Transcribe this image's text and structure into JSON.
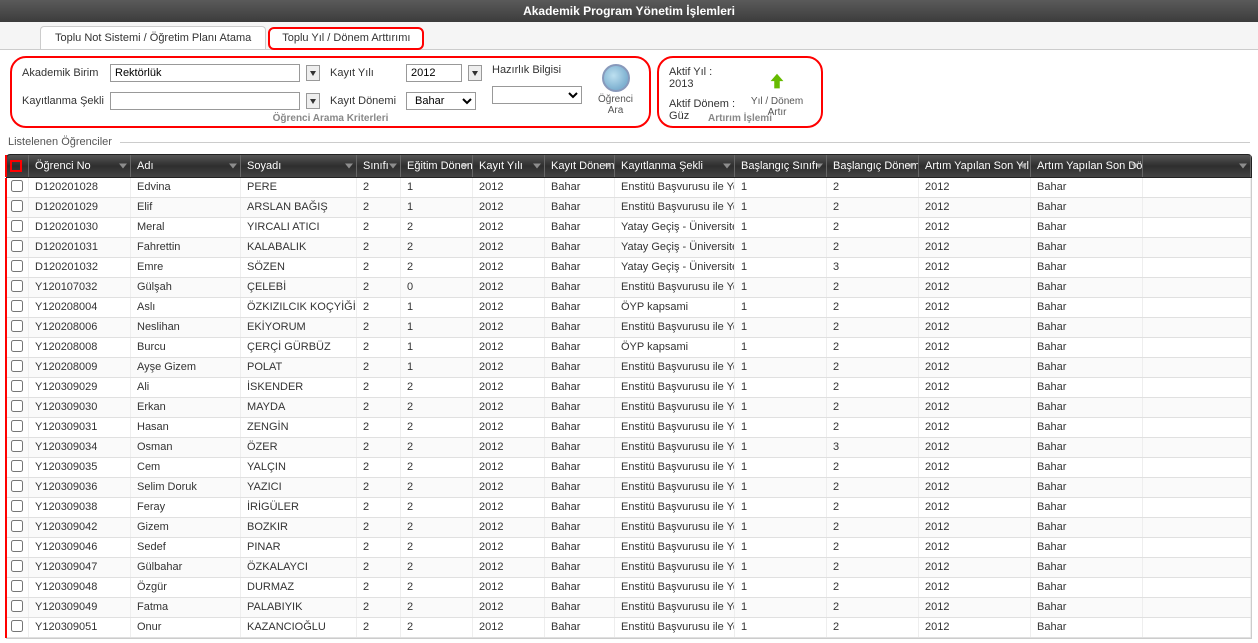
{
  "header": {
    "title": "Akademik Program Yönetim İşlemleri"
  },
  "tabs": [
    {
      "label": "Toplu Not Sistemi / Öğretim Planı Atama"
    },
    {
      "label": "Toplu Yıl / Dönem Arttırımı"
    }
  ],
  "criteria": {
    "title": "Öğrenci Arama Kriterleri",
    "akademik_birim_label": "Akademik Birim",
    "akademik_birim_value": "Rektörlük",
    "kayit_yili_label": "Kayıt Yılı",
    "kayit_yili_value": "2012",
    "hazirlik_label": "Hazırlık Bilgisi",
    "hazirlik_value": "",
    "kayitlanma_label": "Kayıtlanma Şekli",
    "kayitlanma_value": "",
    "kayit_donemi_label": "Kayıt Dönemi",
    "kayit_donemi_value": "Bahar",
    "search_label": "Öğrenci Ara"
  },
  "increment": {
    "title": "Artırım İşlemi",
    "aktif_yil_label": "Aktif Yıl :",
    "aktif_yil_value": "2013",
    "aktif_donem_label": "Aktif Dönem :",
    "aktif_donem_value": "Güz",
    "action_label": "Yıl / Dönem Artır"
  },
  "list_title": "Listelenen Öğrenciler",
  "columns": {
    "ogrno": "Öğrenci No",
    "adi": "Adı",
    "soyadi": "Soyadı",
    "sinifi": "Sınıfı",
    "egitim": "Eğitim Dönem",
    "kayityil": "Kayıt Yılı",
    "kayitdon": "Kayıt Dönemi",
    "kayitsek": "Kayıtlanma Şekli",
    "bassin": "Başlangıç Sınıfı",
    "basdon": "Başlangıç Dönem",
    "artyil": "Artım Yapılan Son Yıl",
    "artdon": "Artım Yapılan Son Dön"
  },
  "rows": [
    {
      "ogrno": "D120201028",
      "adi": "Edvina",
      "soyadi": "PERE",
      "sinifi": "2",
      "egitim": "1",
      "kayityil": "2012",
      "kayitdon": "Bahar",
      "kayitsek": "Enstitü Başvurusu ile Yerl",
      "bassin": "1",
      "basdon": "2",
      "artyil": "2012",
      "artdon": "Bahar"
    },
    {
      "ogrno": "D120201029",
      "adi": "Elif",
      "soyadi": "ARSLAN BAĞIŞ",
      "sinifi": "2",
      "egitim": "1",
      "kayityil": "2012",
      "kayitdon": "Bahar",
      "kayitsek": "Enstitü Başvurusu ile Yerl",
      "bassin": "1",
      "basdon": "2",
      "artyil": "2012",
      "artdon": "Bahar"
    },
    {
      "ogrno": "D120201030",
      "adi": "Meral",
      "soyadi": "YIRCALI ATICI",
      "sinifi": "2",
      "egitim": "2",
      "kayityil": "2012",
      "kayitdon": "Bahar",
      "kayitsek": "Yatay Geçiş - Üniversite İ",
      "bassin": "1",
      "basdon": "2",
      "artyil": "2012",
      "artdon": "Bahar"
    },
    {
      "ogrno": "D120201031",
      "adi": "Fahrettin",
      "soyadi": "KALABALIK",
      "sinifi": "2",
      "egitim": "2",
      "kayityil": "2012",
      "kayitdon": "Bahar",
      "kayitsek": "Yatay Geçiş - Üniversite D",
      "bassin": "1",
      "basdon": "2",
      "artyil": "2012",
      "artdon": "Bahar"
    },
    {
      "ogrno": "D120201032",
      "adi": "Emre",
      "soyadi": "SÖZEN",
      "sinifi": "2",
      "egitim": "2",
      "kayityil": "2012",
      "kayitdon": "Bahar",
      "kayitsek": "Yatay Geçiş - Üniversite İ",
      "bassin": "1",
      "basdon": "3",
      "artyil": "2012",
      "artdon": "Bahar"
    },
    {
      "ogrno": "Y120107032",
      "adi": "Gülşah",
      "soyadi": "ÇELEBİ",
      "sinifi": "2",
      "egitim": "0",
      "kayityil": "2012",
      "kayitdon": "Bahar",
      "kayitsek": "Enstitü Başvurusu ile Yerl",
      "bassin": "1",
      "basdon": "2",
      "artyil": "2012",
      "artdon": "Bahar"
    },
    {
      "ogrno": "Y120208004",
      "adi": "Aslı",
      "soyadi": "ÖZKIZILCIK KOÇYİĞİT",
      "sinifi": "2",
      "egitim": "1",
      "kayityil": "2012",
      "kayitdon": "Bahar",
      "kayitsek": "ÖYP kapsami",
      "bassin": "1",
      "basdon": "2",
      "artyil": "2012",
      "artdon": "Bahar"
    },
    {
      "ogrno": "Y120208006",
      "adi": "Neslihan",
      "soyadi": "EKİYORUM",
      "sinifi": "2",
      "egitim": "1",
      "kayityil": "2012",
      "kayitdon": "Bahar",
      "kayitsek": "Enstitü Başvurusu ile Yerl",
      "bassin": "1",
      "basdon": "2",
      "artyil": "2012",
      "artdon": "Bahar"
    },
    {
      "ogrno": "Y120208008",
      "adi": "Burcu",
      "soyadi": "ÇERÇİ GÜRBÜZ",
      "sinifi": "2",
      "egitim": "1",
      "kayityil": "2012",
      "kayitdon": "Bahar",
      "kayitsek": "ÖYP kapsami",
      "bassin": "1",
      "basdon": "2",
      "artyil": "2012",
      "artdon": "Bahar"
    },
    {
      "ogrno": "Y120208009",
      "adi": "Ayşe Gizem",
      "soyadi": "POLAT",
      "sinifi": "2",
      "egitim": "1",
      "kayityil": "2012",
      "kayitdon": "Bahar",
      "kayitsek": "Enstitü Başvurusu ile Yerl",
      "bassin": "1",
      "basdon": "2",
      "artyil": "2012",
      "artdon": "Bahar"
    },
    {
      "ogrno": "Y120309029",
      "adi": "Ali",
      "soyadi": "İSKENDER",
      "sinifi": "2",
      "egitim": "2",
      "kayityil": "2012",
      "kayitdon": "Bahar",
      "kayitsek": "Enstitü Başvurusu ile Yerl",
      "bassin": "1",
      "basdon": "2",
      "artyil": "2012",
      "artdon": "Bahar"
    },
    {
      "ogrno": "Y120309030",
      "adi": "Erkan",
      "soyadi": "MAYDA",
      "sinifi": "2",
      "egitim": "2",
      "kayityil": "2012",
      "kayitdon": "Bahar",
      "kayitsek": "Enstitü Başvurusu ile Yerl",
      "bassin": "1",
      "basdon": "2",
      "artyil": "2012",
      "artdon": "Bahar"
    },
    {
      "ogrno": "Y120309031",
      "adi": "Hasan",
      "soyadi": "ZENGİN",
      "sinifi": "2",
      "egitim": "2",
      "kayityil": "2012",
      "kayitdon": "Bahar",
      "kayitsek": "Enstitü Başvurusu ile Yerl",
      "bassin": "1",
      "basdon": "2",
      "artyil": "2012",
      "artdon": "Bahar"
    },
    {
      "ogrno": "Y120309034",
      "adi": "Osman",
      "soyadi": "ÖZER",
      "sinifi": "2",
      "egitim": "2",
      "kayityil": "2012",
      "kayitdon": "Bahar",
      "kayitsek": "Enstitü Başvurusu ile Yerl",
      "bassin": "1",
      "basdon": "3",
      "artyil": "2012",
      "artdon": "Bahar"
    },
    {
      "ogrno": "Y120309035",
      "adi": "Cem",
      "soyadi": "YALÇIN",
      "sinifi": "2",
      "egitim": "2",
      "kayityil": "2012",
      "kayitdon": "Bahar",
      "kayitsek": "Enstitü Başvurusu ile Yerl",
      "bassin": "1",
      "basdon": "2",
      "artyil": "2012",
      "artdon": "Bahar"
    },
    {
      "ogrno": "Y120309036",
      "adi": "Selim Doruk",
      "soyadi": "YAZICI",
      "sinifi": "2",
      "egitim": "2",
      "kayityil": "2012",
      "kayitdon": "Bahar",
      "kayitsek": "Enstitü Başvurusu ile Yerl",
      "bassin": "1",
      "basdon": "2",
      "artyil": "2012",
      "artdon": "Bahar"
    },
    {
      "ogrno": "Y120309038",
      "adi": "Feray",
      "soyadi": "İRİGÜLER",
      "sinifi": "2",
      "egitim": "2",
      "kayityil": "2012",
      "kayitdon": "Bahar",
      "kayitsek": "Enstitü Başvurusu ile Yerl",
      "bassin": "1",
      "basdon": "2",
      "artyil": "2012",
      "artdon": "Bahar"
    },
    {
      "ogrno": "Y120309042",
      "adi": "Gizem",
      "soyadi": "BOZKIR",
      "sinifi": "2",
      "egitim": "2",
      "kayityil": "2012",
      "kayitdon": "Bahar",
      "kayitsek": "Enstitü Başvurusu ile Yerl",
      "bassin": "1",
      "basdon": "2",
      "artyil": "2012",
      "artdon": "Bahar"
    },
    {
      "ogrno": "Y120309046",
      "adi": "Sedef",
      "soyadi": "PINAR",
      "sinifi": "2",
      "egitim": "2",
      "kayityil": "2012",
      "kayitdon": "Bahar",
      "kayitsek": "Enstitü Başvurusu ile Yerl",
      "bassin": "1",
      "basdon": "2",
      "artyil": "2012",
      "artdon": "Bahar"
    },
    {
      "ogrno": "Y120309047",
      "adi": "Gülbahar",
      "soyadi": "ÖZKALAYCI",
      "sinifi": "2",
      "egitim": "2",
      "kayityil": "2012",
      "kayitdon": "Bahar",
      "kayitsek": "Enstitü Başvurusu ile Yerl",
      "bassin": "1",
      "basdon": "2",
      "artyil": "2012",
      "artdon": "Bahar"
    },
    {
      "ogrno": "Y120309048",
      "adi": "Özgür",
      "soyadi": "DURMAZ",
      "sinifi": "2",
      "egitim": "2",
      "kayityil": "2012",
      "kayitdon": "Bahar",
      "kayitsek": "Enstitü Başvurusu ile Yerl",
      "bassin": "1",
      "basdon": "2",
      "artyil": "2012",
      "artdon": "Bahar"
    },
    {
      "ogrno": "Y120309049",
      "adi": "Fatma",
      "soyadi": "PALABIYIK",
      "sinifi": "2",
      "egitim": "2",
      "kayityil": "2012",
      "kayitdon": "Bahar",
      "kayitsek": "Enstitü Başvurusu ile Yerl",
      "bassin": "1",
      "basdon": "2",
      "artyil": "2012",
      "artdon": "Bahar"
    },
    {
      "ogrno": "Y120309051",
      "adi": "Onur",
      "soyadi": "KAZANCIOĞLU",
      "sinifi": "2",
      "egitim": "2",
      "kayityil": "2012",
      "kayitdon": "Bahar",
      "kayitsek": "Enstitü Başvurusu ile Yerl",
      "bassin": "1",
      "basdon": "2",
      "artyil": "2012",
      "artdon": "Bahar"
    }
  ]
}
